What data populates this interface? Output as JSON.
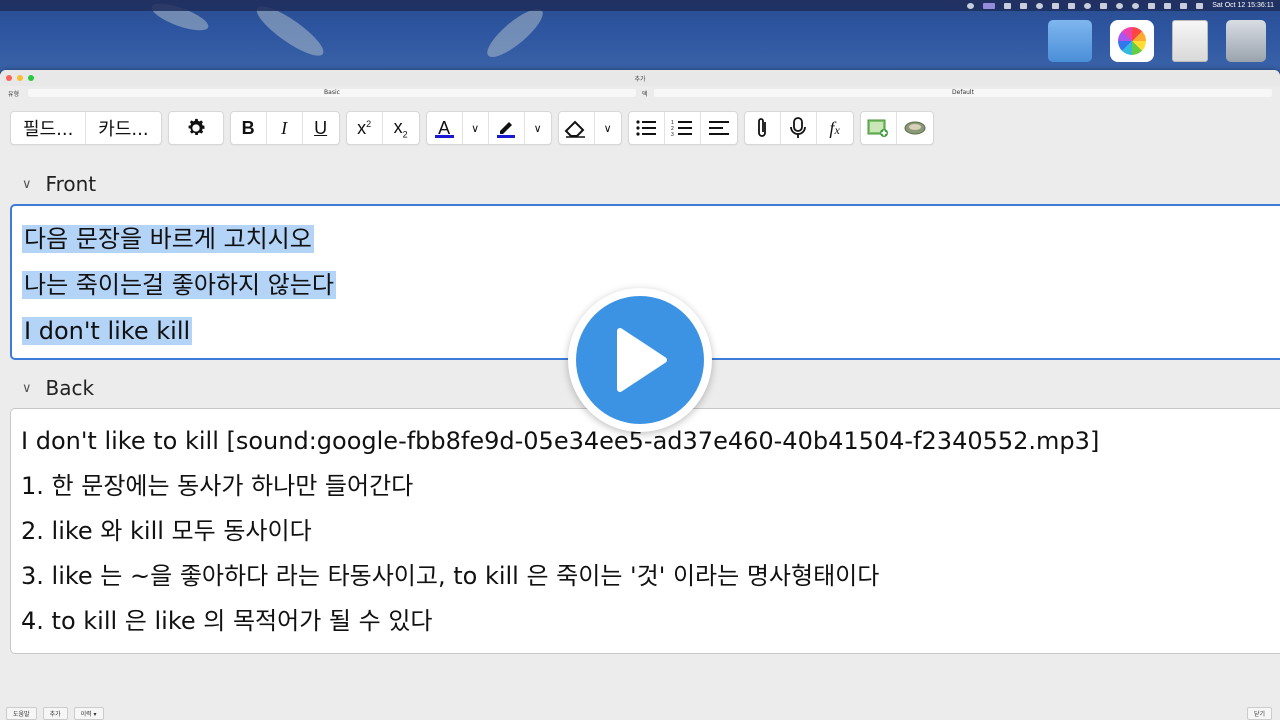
{
  "menubar": {
    "clock": "Sat Oct 12  15:36:11"
  },
  "window": {
    "title": "추가"
  },
  "typebar": {
    "type_label": "유형",
    "type_value": "Basic",
    "deck_label": "덱",
    "deck_value": "Default"
  },
  "toolbar": {
    "fields_label": "필드...",
    "cards_label": "카드...",
    "bold_label": "B",
    "italic_label": "I",
    "underline_label": "U",
    "text_color_label": "A"
  },
  "front": {
    "header": "Front",
    "lines": [
      "다음 문장을 바르게 고치시오",
      "나는 죽이는걸 좋아하지 않는다",
      "I don't like kill"
    ]
  },
  "back": {
    "header": "Back",
    "lines": [
      "I don't like to kill [sound:google-fbb8fe9d-05e34ee5-ad37e460-40b41504-f2340552.mp3]",
      "1. 한 문장에는 동사가 하나만 들어간다",
      "2. like 와 kill 모두 동사이다",
      "3. like 는 ~을 좋아하다 라는 타동사이고, to kill 은 죽이는 '것' 이라는 명사형태이다",
      "4. to kill 은 like 의 목적어가 될 수 있다"
    ]
  },
  "bottom": {
    "help": "도움말",
    "add": "추가",
    "history": "이력 ▾",
    "close": "닫기"
  },
  "colors": {
    "accent": "#3d7bd9",
    "selection": "#b3d3f7",
    "play": "#3c93e4"
  }
}
